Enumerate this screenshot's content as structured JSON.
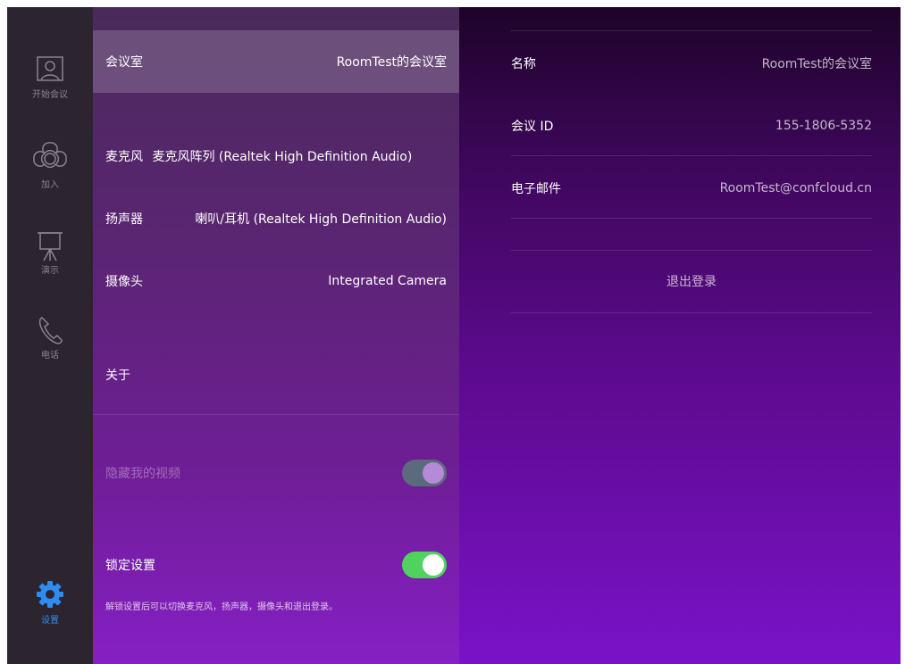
{
  "nav": {
    "items": [
      {
        "label": "开始会议",
        "icon": "person-frame-icon"
      },
      {
        "label": "加入",
        "icon": "join-petals-icon"
      },
      {
        "label": "演示",
        "icon": "presentation-board-icon"
      },
      {
        "label": "电话",
        "icon": "phone-icon"
      },
      {
        "label": "设置",
        "icon": "gear-icon"
      }
    ],
    "active_color": "#2e8cf0"
  },
  "settings": {
    "room": {
      "label": "会议室",
      "value": "RoomTest的会议室"
    },
    "mic": {
      "label": "麦克风",
      "value": "麦克风阵列 (Realtek High Definition Audio)"
    },
    "speaker": {
      "label": "扬声器",
      "value": "喇叭/耳机 (Realtek High Definition Audio)"
    },
    "camera": {
      "label": "摄像头",
      "value": "Integrated Camera"
    },
    "about": {
      "label": "关于"
    },
    "hide_video": {
      "label": "隐藏我的视频",
      "enabled": true
    },
    "lock": {
      "label": "锁定设置",
      "enabled": true,
      "note": "解锁设置后可以切换麦克风，扬声器，摄像头和退出登录。"
    }
  },
  "detail": {
    "name": {
      "label": "名称",
      "value": "RoomTest的会议室"
    },
    "meeting_id": {
      "label": "会议 ID",
      "value": "155-1806-5352"
    },
    "email": {
      "label": "电子邮件",
      "value": "RoomTest@confcloud.cn"
    },
    "logout_label": "退出登录"
  },
  "colors": {
    "toggle_on": "#4fd25e",
    "toggle_disabled": "#5c6a7e"
  }
}
